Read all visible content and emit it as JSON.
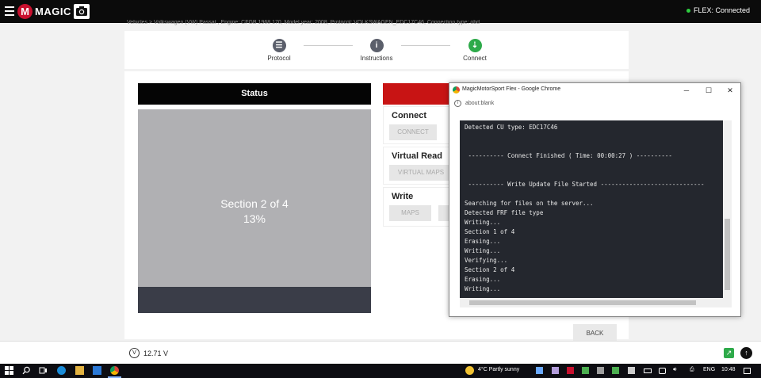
{
  "topbar": {
    "logo_text": "MAGIC",
    "flex_status": "FLEX: Connected"
  },
  "breadcrumb": "Vehicles   >   Volkswagen (VW) Passat , Engine: CFGB 1968 170, Model year: 2008, Protocol: VOLKSWAGEN_EDC17C46, Connection type: obd",
  "stepper": {
    "steps": [
      {
        "label": "Protocol",
        "icon": "list-icon",
        "color": "#5b5f6b"
      },
      {
        "label": "Instructions",
        "icon": "info-icon",
        "color": "#5b5f6b"
      },
      {
        "label": "Connect",
        "icon": "plug-icon",
        "color": "#2eaa4a"
      }
    ]
  },
  "status": {
    "header": "Status",
    "section": "Section 2 of 4",
    "percent": "13%"
  },
  "actions": {
    "connect_title": "Connect",
    "connect_btn": "CONNECT",
    "virtual_read_title": "Virtual Read",
    "virtual_maps_btn": "VIRTUAL MAPS",
    "write_title": "Write",
    "maps_btn": "MAPS"
  },
  "back_label": "BACK",
  "footer": {
    "voltage": "12.71 V"
  },
  "popup": {
    "title": "MagicMotorSport Flex - Google Chrome",
    "url": "about:blank",
    "lines": [
      "Detected CU type: EDC17C46",
      "",
      "",
      " ---------- Connect Finished ( Time: 00:00:27 ) ----------",
      "",
      "",
      " ---------- Write Update File Started -----------------------------",
      "",
      "Searching for files on the server...",
      "Detected FRF file type",
      "Writing...",
      "Section 1 of 4",
      "Erasing...",
      "Writing...",
      "Verifying...",
      "Section 2 of 4",
      "Erasing...",
      "Writing..."
    ]
  },
  "taskbar": {
    "weather": "4°C  Partly sunny",
    "lang": "ENG",
    "time": "10:48"
  },
  "colors": {
    "brand_red": "#c81414",
    "connected_green": "#2ecc40",
    "console_bg": "#24272e"
  }
}
